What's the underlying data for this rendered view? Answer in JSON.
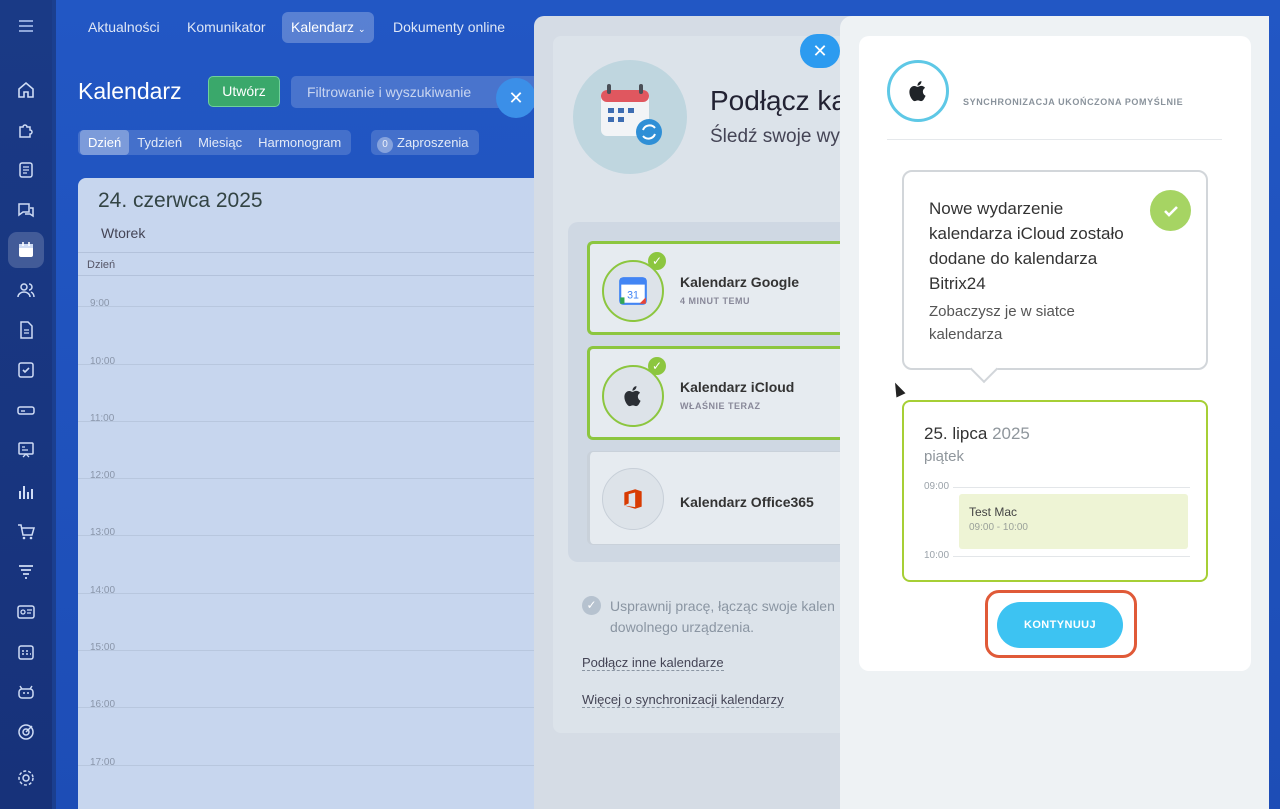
{
  "rail": {
    "icons": [
      "menu-icon",
      "home-icon",
      "puzzle-icon",
      "feed-icon",
      "chat-icon",
      "calendar-icon",
      "people-icon",
      "document-icon",
      "tasks-icon",
      "drive-icon",
      "presentation-icon",
      "analytics-icon",
      "shop-icon",
      "funnel-icon",
      "contact-card-icon",
      "schedule-icon",
      "robot-icon",
      "target-icon",
      "settings-icon"
    ]
  },
  "topnav": {
    "items": [
      "Aktualności",
      "Komunikator",
      "Kalendarz",
      "Dokumenty online"
    ]
  },
  "calendar": {
    "title": "Kalendarz",
    "create_label": "Utwórz",
    "filter_placeholder": "Filtrowanie i wyszukiwanie",
    "views": [
      "Dzień",
      "Tydzień",
      "Miesiąc",
      "Harmonogram"
    ],
    "invites_count": "0",
    "invites_label": "Zaproszenia",
    "date": "24. czerwca 2025",
    "weekday": "Wtorek",
    "column_label": "Dzień",
    "hours": [
      "9:00",
      "10:00",
      "11:00",
      "12:00",
      "13:00",
      "14:00",
      "15:00",
      "16:00",
      "17:00"
    ]
  },
  "connect_panel": {
    "close_label": "✕",
    "title": "Podłącz ka",
    "subtitle": "Śledź swoje wy",
    "providers": [
      {
        "name": "Kalendarz Google",
        "status": "4 MINUT TEMU"
      },
      {
        "name": "Kalendarz iCloud",
        "status": "WŁAŚNIE TERAZ"
      },
      {
        "name": "Kalendarz Office365",
        "status": ""
      }
    ],
    "note": "Usprawnij pracę, łącząc swoje kalen dowolnego urządzenia.",
    "link_other": "Podłącz inne kalendarze",
    "link_more": "Więcej o synchronizacji kalendarzy"
  },
  "sync_panel": {
    "status": "SYNCHRONIZACJA UKOŃCZONA POMYŚLNIE",
    "message_title": "Nowe wydarzenie kalendarza iCloud zostało dodane do kalendarza Bitrix24",
    "message_sub": "Zobaczysz je w siatce kalendarza",
    "event_day": "25. lipca",
    "event_year": "2025",
    "event_weekday": "piątek",
    "time_start": "09:00",
    "time_end": "10:00",
    "event_name": "Test Mac",
    "event_time": "09:00 - 10:00",
    "continue_label": "KONTYNUUJ"
  },
  "colors": {
    "accent_blue": "#3dc3f2",
    "success_green": "#a6d463",
    "highlight_red": "#e05a38"
  }
}
